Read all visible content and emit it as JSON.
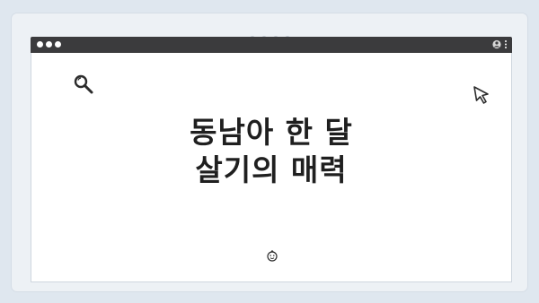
{
  "page": {
    "background": "#dfe7ef",
    "card_background": "#edf1f5"
  },
  "browser": {
    "bar_color": "#3b3b3d",
    "content_background": "#ffffff"
  },
  "icons": {
    "top_indicator": "carousel-dots",
    "window_controls": "three-dots",
    "profile": "user-icon",
    "menu": "vertical-dots-icon",
    "search": "search-icon",
    "cursor": "cursor-icon",
    "smiley": "smiley-icon"
  },
  "content": {
    "title_line1": "동남아 한 달",
    "title_line2": "살기의 매력"
  }
}
